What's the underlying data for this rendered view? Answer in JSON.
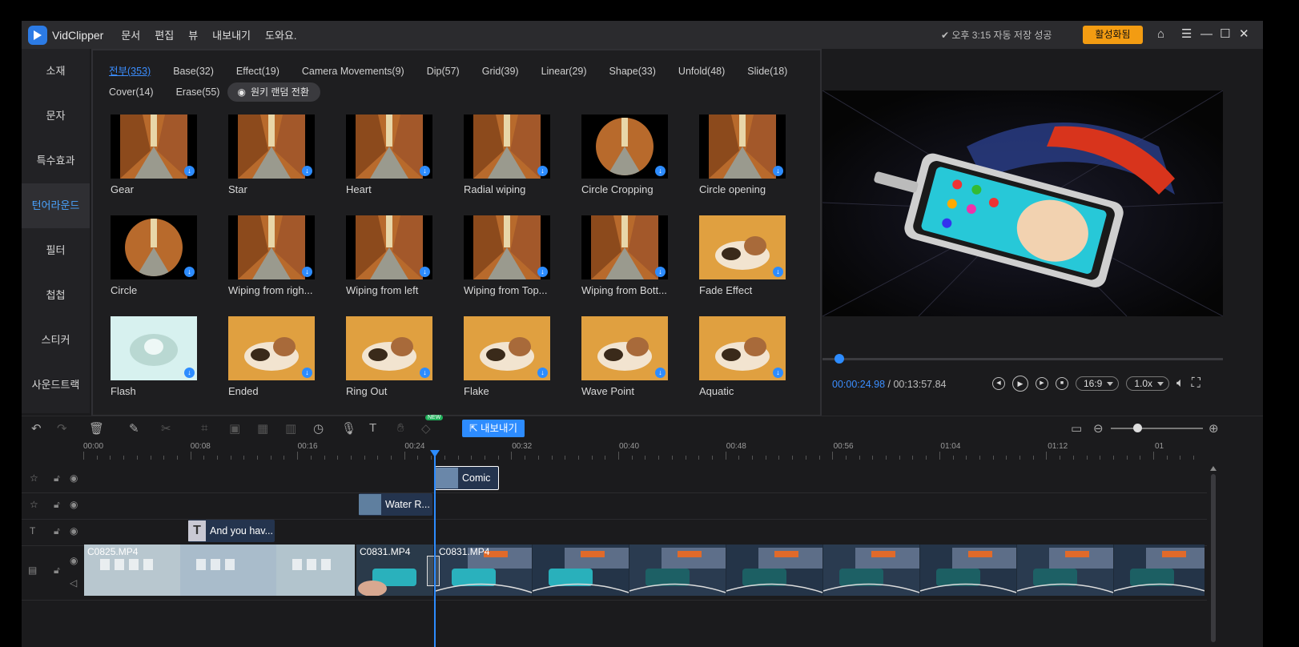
{
  "app": {
    "name": "VidClipper",
    "menu": [
      "문서",
      "편집",
      "뷰",
      "내보내기",
      "도와요."
    ],
    "save_status": "✔ 오후 3:15 자동 저장 성공",
    "activate_label": "활성화됨"
  },
  "sidebar": {
    "items": [
      "소재",
      "문자",
      "특수효과",
      "턴어라운드",
      "필터",
      "첩첩",
      "스티커",
      "사운드트랙"
    ],
    "active": "턴어라운드"
  },
  "library": {
    "categories_row1": [
      "전부(353)",
      "Base(32)",
      "Effect(19)",
      "Camera Movements(9)",
      "Dip(57)",
      "Grid(39)",
      "Linear(29)",
      "Shape(33)",
      "Unfold(48)",
      "Slide(18)"
    ],
    "categories_row2": [
      "Cover(14)",
      "Erase(55)"
    ],
    "random_button": "원키 랜덤 전환",
    "transitions": [
      {
        "name": "Gear",
        "style": "alley"
      },
      {
        "name": "Star",
        "style": "alley"
      },
      {
        "name": "Heart",
        "style": "alley"
      },
      {
        "name": "Radial wiping",
        "style": "alley"
      },
      {
        "name": "Circle Cropping",
        "style": "circle"
      },
      {
        "name": "Circle opening",
        "style": "alley"
      },
      {
        "name": "Circle",
        "style": "circle"
      },
      {
        "name": "Wiping from righ...",
        "style": "alley"
      },
      {
        "name": "Wiping from left",
        "style": "alley"
      },
      {
        "name": "Wiping from Top...",
        "style": "alley"
      },
      {
        "name": "Wiping from Bott...",
        "style": "alley"
      },
      {
        "name": "Fade Effect",
        "style": "cat"
      },
      {
        "name": "Flash",
        "style": "flash"
      },
      {
        "name": "Ended",
        "style": "cat"
      },
      {
        "name": "Ring Out",
        "style": "cat"
      },
      {
        "name": "Flake",
        "style": "cat"
      },
      {
        "name": "Wave Point",
        "style": "cat"
      },
      {
        "name": "Aquatic",
        "style": "cat"
      }
    ]
  },
  "preview": {
    "current_time": "00:00:24.98",
    "separator": " / ",
    "total_time": "00:13:57.84",
    "aspect": "16:9",
    "speed": "1.0x",
    "progress": 0.03
  },
  "toolbar": {
    "export_label": "내보내기",
    "new_badge": "NEW"
  },
  "timeline": {
    "ruler": [
      "00:00",
      "00:08",
      "00:16",
      "00:24",
      "00:32",
      "00:40",
      "00:48",
      "00:56",
      "01:04",
      "01:12",
      "01"
    ],
    "clips": {
      "effect": "Comic",
      "filter": "Water R...",
      "text": "And you hav...",
      "video1": "C0825.MP4",
      "video2": "C0831.MP4",
      "video3": "C0831.MP4"
    }
  },
  "colors": {
    "accent": "#2d8cff",
    "activate": "#f39c12",
    "background": "#1b1b1d"
  }
}
